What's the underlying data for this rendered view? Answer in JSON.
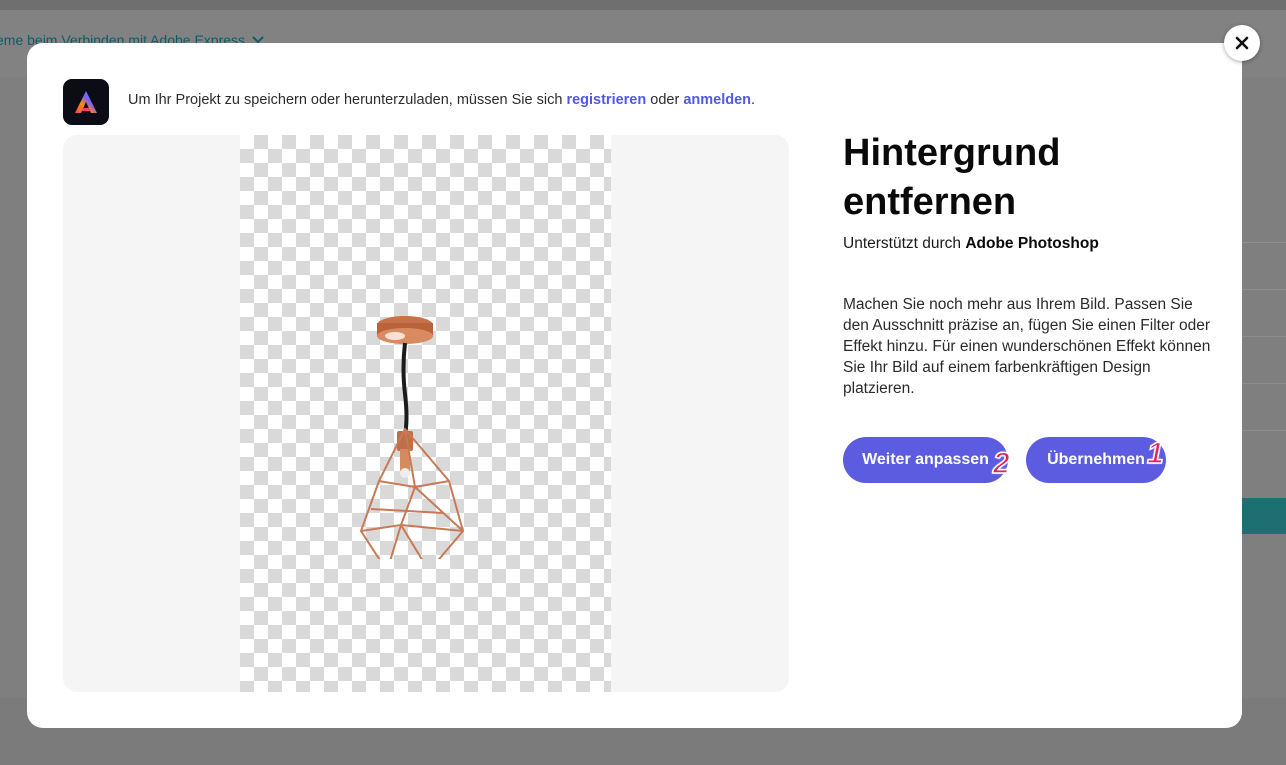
{
  "background": {
    "help_link": "eme beim Verbinden mit Adobe Express"
  },
  "modal": {
    "close_icon": "close-icon",
    "logo_icon": "adobe-express-logo",
    "notice_prefix": "Um Ihr Projekt zu speichern oder herunterzuladen, müssen Sie sich ",
    "notice_register": "registrieren",
    "notice_middle": " oder ",
    "notice_login": "anmelden",
    "notice_suffix": ".",
    "title": "Hintergrund entfernen",
    "powered_prefix": "Unterstützt durch ",
    "powered_brand": "Adobe Photoshop",
    "description": "Machen Sie noch mehr aus Ihrem Bild. Passen Sie den Ausschnitt präzise an, fügen Sie einen Filter oder Effekt hinzu. Für einen wunderschönen Effekt können Sie Ihr Bild auf einem farbenkräftigen Design platzieren.",
    "continue_button": "Weiter anpassen",
    "apply_button": "Übernehmen",
    "badge_continue": "2",
    "badge_apply": "1"
  },
  "colors": {
    "accent": "#5c5ce0",
    "link": "#5258e4",
    "badge": "#e0245e"
  }
}
